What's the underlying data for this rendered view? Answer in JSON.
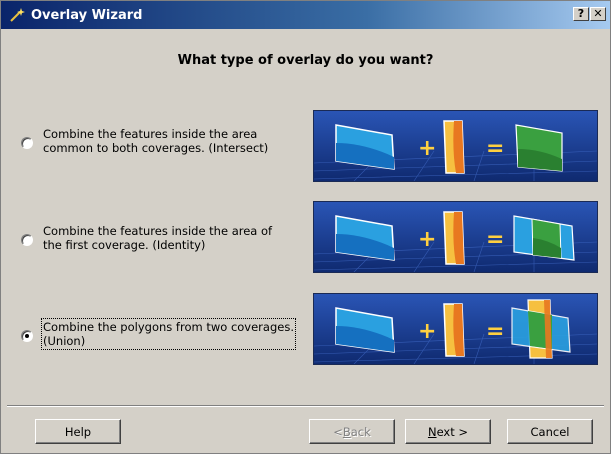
{
  "window": {
    "title": "Overlay Wizard",
    "help_button": "?",
    "close_button": "✕"
  },
  "heading": "What type of overlay do you want?",
  "options": [
    {
      "line1": "Combine the features inside the area",
      "line2": "common to both coverages. (Intersect)",
      "selected": false
    },
    {
      "line1": "Combine the features inside the area of",
      "line2": "the first coverage. (Identity)",
      "selected": false
    },
    {
      "line1": "Combine the polygons from two coverages.",
      "line2": "(Union)",
      "selected": true
    }
  ],
  "illustration": {
    "plus": "+",
    "equals": "="
  },
  "buttons": {
    "help": "Help",
    "back_prefix": "< ",
    "back_key": "B",
    "back_rest": "ack",
    "next_key": "N",
    "next_rest": "ext >",
    "cancel": "Cancel"
  },
  "colors": {
    "title_start": "#0a246a",
    "title_end": "#a6caf0",
    "panel_bg": "#1e3d8f",
    "blue_layer": "#2aa0e0",
    "orange_layer": "#f0a020",
    "green_layer": "#3aa040"
  }
}
